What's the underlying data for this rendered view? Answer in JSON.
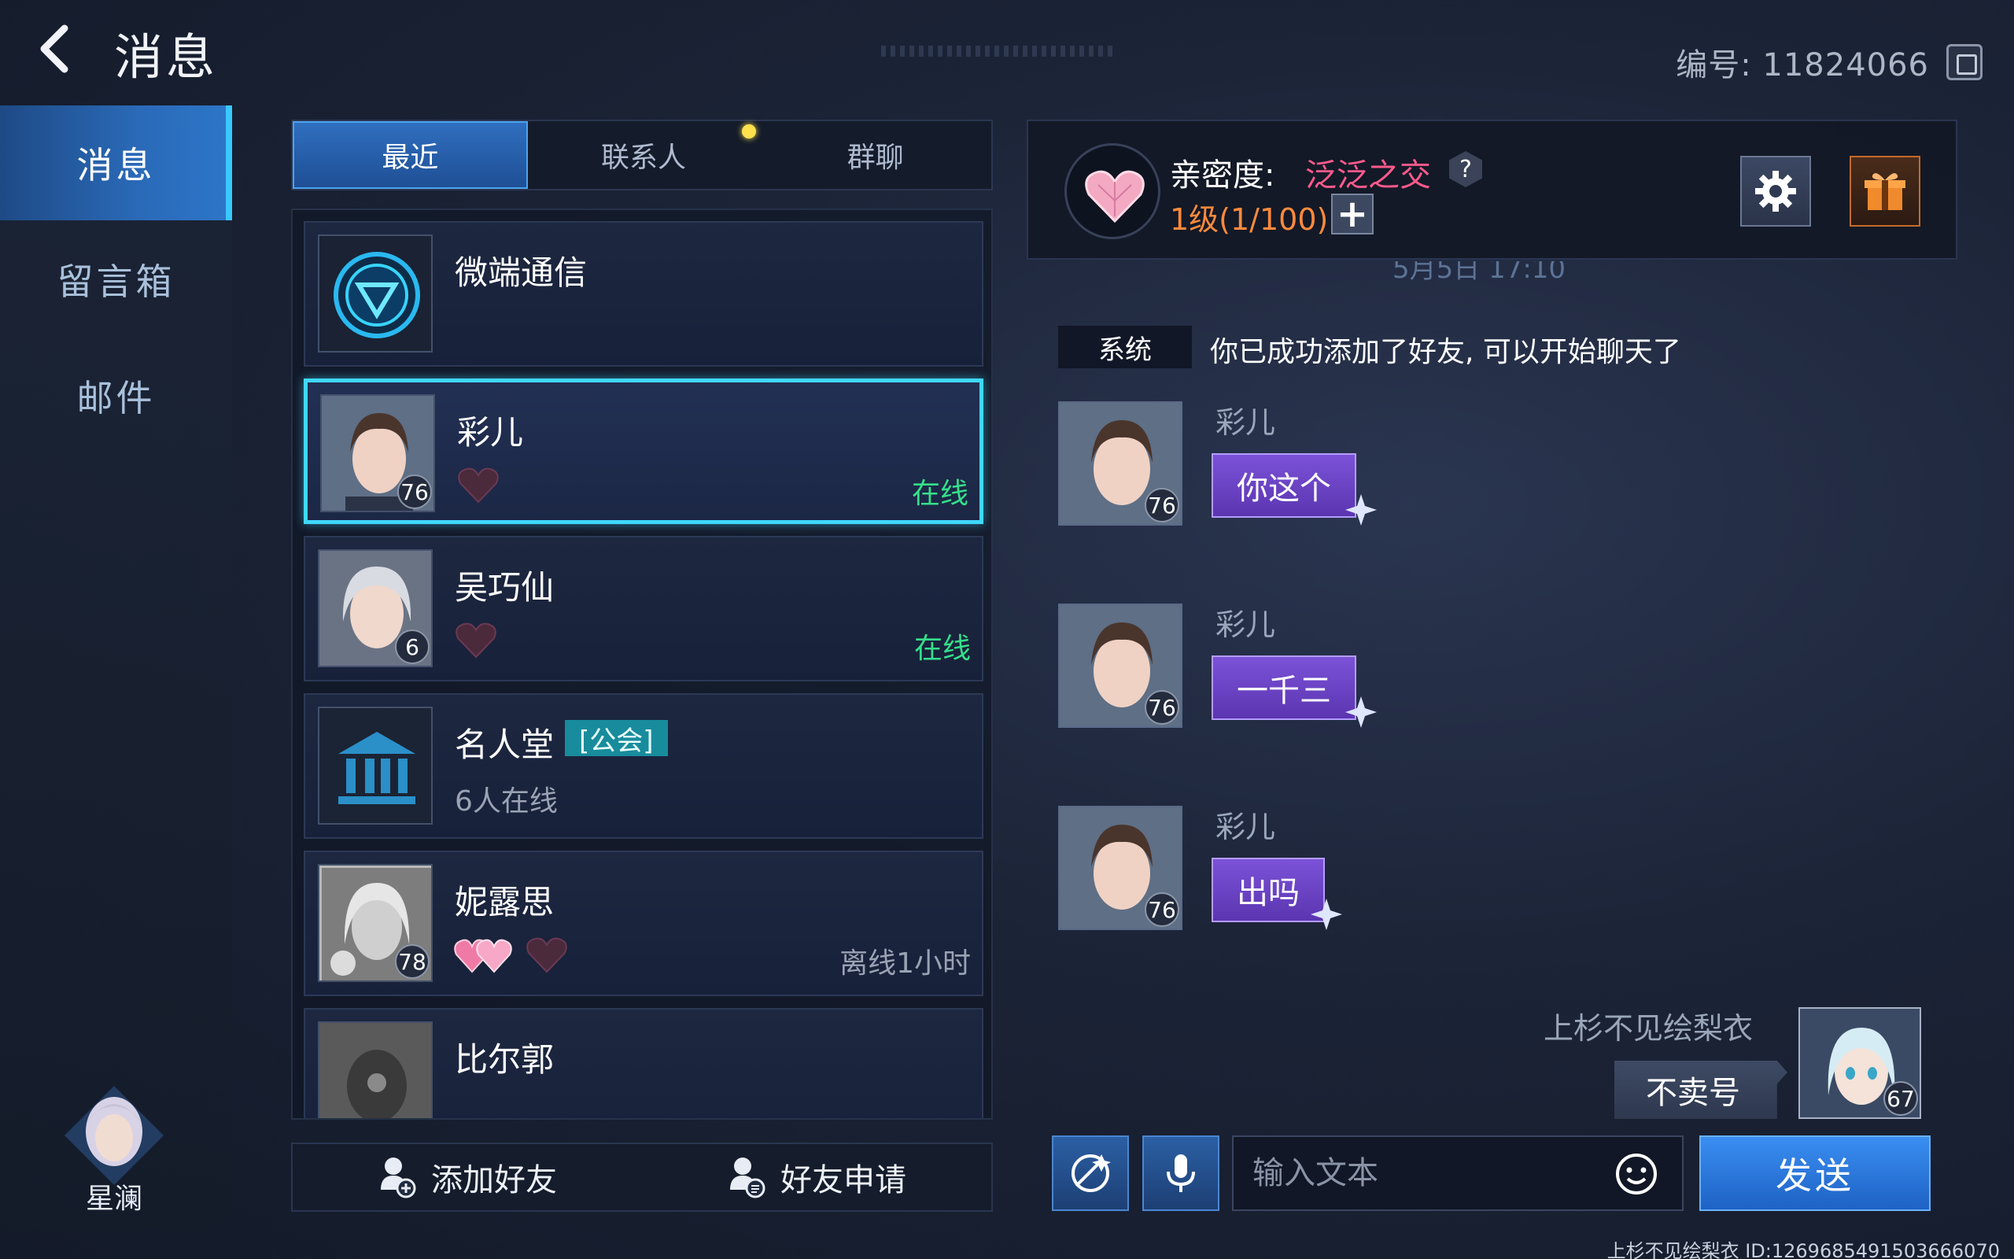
{
  "header": {
    "title": "消息",
    "account_id": "编号: 11824066"
  },
  "sidebar": {
    "items": [
      {
        "label": "消息",
        "active": true
      },
      {
        "label": "留言箱",
        "active": false
      },
      {
        "label": "邮件",
        "active": false
      }
    ],
    "player_name": "星澜"
  },
  "tabs": [
    {
      "label": "最近",
      "active": true
    },
    {
      "label": "联系人",
      "active": false
    },
    {
      "label": "群聊",
      "active": false
    }
  ],
  "contacts": [
    {
      "name": "微端通信",
      "type": "system"
    },
    {
      "name": "彩儿",
      "level": "76",
      "status": "在线",
      "selected": true
    },
    {
      "name": "吴巧仙",
      "level": "6",
      "status": "在线"
    },
    {
      "name": "名人堂",
      "tag": "[公会]",
      "sub": "6人在线",
      "type": "guild"
    },
    {
      "name": "妮露思",
      "level": "78",
      "status": "离线1小时"
    },
    {
      "name": "比尔郭",
      "level": "",
      "status": ""
    }
  ],
  "list_actions": {
    "add_friend": "添加好友",
    "friend_requests": "好友申请"
  },
  "chat": {
    "intimacy_label": "亲密度:",
    "intimacy_value": "泛泛之交",
    "level": "1级(1/100)",
    "date": "5月5日 17:10",
    "system_tag": "系统",
    "system_text": "你已成功添加了好友, 可以开始聊天了",
    "messages": [
      {
        "sender": "彩儿",
        "level": "76",
        "text": "你这个"
      },
      {
        "sender": "彩儿",
        "level": "76",
        "text": "一千三"
      },
      {
        "sender": "彩儿",
        "level": "76",
        "text": "出吗"
      }
    ],
    "self_message": {
      "sender": "上杉不见绘梨衣",
      "level": "67",
      "text": "不卖号"
    },
    "input_placeholder": "输入文本",
    "send_label": "发送"
  },
  "footer": {
    "id_text": "上杉不见绘梨衣  ID:1269685491503666070"
  },
  "colors": {
    "accent": "#3fd8ff",
    "online": "#35e08a",
    "bubble": "#6a44c4",
    "intimacy": "#ff5a8c",
    "level": "#ff8a3c"
  },
  "icons": [
    "back-arrow-icon",
    "copy-icon",
    "settings-gear-icon",
    "gift-icon",
    "help-icon",
    "plus-icon",
    "emote-icon",
    "microphone-icon",
    "emoji-smile-icon",
    "add-friend-icon",
    "friend-request-icon",
    "heart-icon",
    "guild-hall-icon",
    "signal-logo-icon"
  ]
}
